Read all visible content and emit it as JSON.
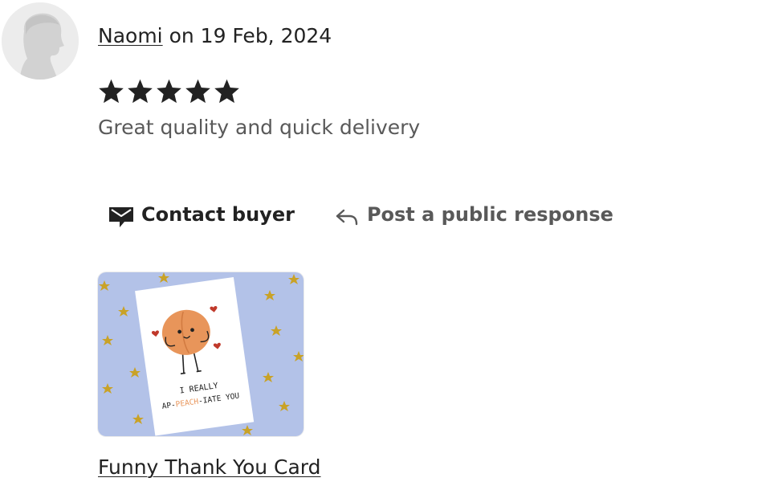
{
  "review": {
    "reviewer_name": "Naomi",
    "date_text": "on 19 Feb, 2024",
    "rating": 5,
    "rating_max": 5,
    "text": "Great quality and quick delivery"
  },
  "actions": {
    "contact_label": "Contact buyer",
    "contact_icon": "envelope-icon",
    "respond_label": "Post a public response",
    "respond_icon": "reply-arrow-icon"
  },
  "product": {
    "title": "Funny Thank You Card",
    "card_line1": "I REALLY",
    "card_line2_pre": "AP-",
    "card_line2_accent": "PEACH",
    "card_line2_post": "-IATE YOU"
  },
  "colors": {
    "text_primary": "#222222",
    "text_secondary": "#595959",
    "thumb_background": "#b3c2e8",
    "star_confetti": "#c9a227",
    "peach": "#e8955a",
    "heart": "#c0392b"
  }
}
